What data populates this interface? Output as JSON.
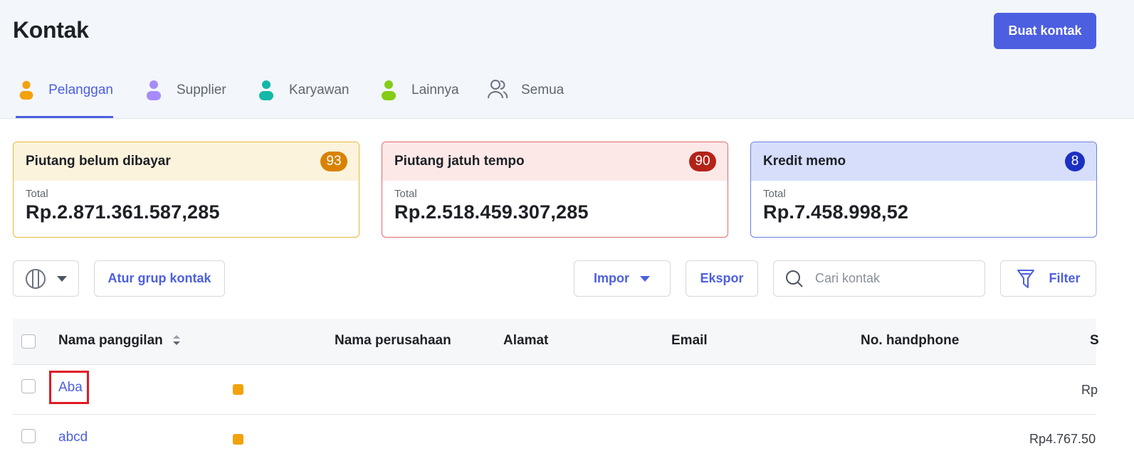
{
  "header": {
    "title": "Kontak",
    "create_button": "Buat kontak"
  },
  "tabs": [
    {
      "label": "Pelanggan",
      "icon": "person-icon",
      "color": "#f2a20c",
      "active": true
    },
    {
      "label": "Supplier",
      "icon": "person-icon",
      "color": "#a78bfa",
      "active": false
    },
    {
      "label": "Karyawan",
      "icon": "person-icon",
      "color": "#14b8a6",
      "active": false
    },
    {
      "label": "Lainnya",
      "icon": "person-icon",
      "color": "#84cc16",
      "active": false
    },
    {
      "label": "Semua",
      "icon": "people-outline-icon",
      "color": "#6b7280",
      "active": false
    }
  ],
  "cards": [
    {
      "title": "Piutang belum dibayar",
      "count": "93",
      "total_label": "Total",
      "total": "Rp.2.871.361.587,285",
      "header_bg": "#fcf3dc",
      "border": "#e6b93a",
      "badge_color": "#d98200"
    },
    {
      "title": "Piutang jatuh tempo",
      "count": "90",
      "total_label": "Total",
      "total": "Rp.2.518.459.307,285",
      "header_bg": "#fde8e8",
      "border": "#e06a6a",
      "badge_color": "#b42318"
    },
    {
      "title": "Kredit memo",
      "count": "8",
      "total_label": "Total",
      "total": "Rp.7.458.998,52",
      "header_bg": "#d6defc",
      "border": "#6b7fe0",
      "badge_color": "#1b2fc2"
    }
  ],
  "toolbar": {
    "group_button": "Atur grup kontak",
    "import_button": "Impor",
    "export_button": "Ekspor",
    "search_placeholder": "Cari kontak",
    "filter_button": "Filter"
  },
  "table": {
    "columns": [
      "Nama panggilan",
      "Nama perusahaan",
      "Alamat",
      "Email",
      "No. handphone",
      "S"
    ],
    "rows": [
      {
        "name": "Aba",
        "amount": "Rp"
      },
      {
        "name": "abcd",
        "amount": "Rp4.767.50"
      }
    ]
  },
  "colors": {
    "accent": "#4c5fe0",
    "tag": "#f2a20c"
  }
}
